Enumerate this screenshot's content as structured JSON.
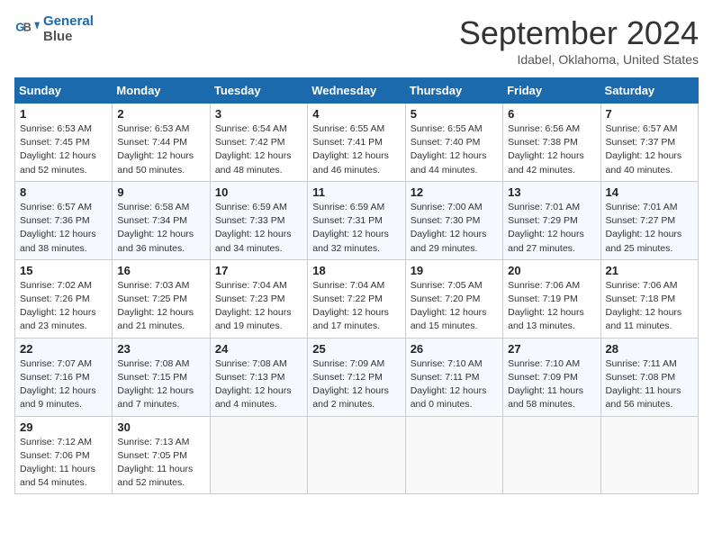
{
  "header": {
    "logo_line1": "General",
    "logo_line2": "Blue",
    "month": "September 2024",
    "location": "Idabel, Oklahoma, United States"
  },
  "weekdays": [
    "Sunday",
    "Monday",
    "Tuesday",
    "Wednesday",
    "Thursday",
    "Friday",
    "Saturday"
  ],
  "weeks": [
    [
      {
        "day": "1",
        "sunrise": "6:53 AM",
        "sunset": "7:45 PM",
        "daylight": "12 hours and 52 minutes."
      },
      {
        "day": "2",
        "sunrise": "6:53 AM",
        "sunset": "7:44 PM",
        "daylight": "12 hours and 50 minutes."
      },
      {
        "day": "3",
        "sunrise": "6:54 AM",
        "sunset": "7:42 PM",
        "daylight": "12 hours and 48 minutes."
      },
      {
        "day": "4",
        "sunrise": "6:55 AM",
        "sunset": "7:41 PM",
        "daylight": "12 hours and 46 minutes."
      },
      {
        "day": "5",
        "sunrise": "6:55 AM",
        "sunset": "7:40 PM",
        "daylight": "12 hours and 44 minutes."
      },
      {
        "day": "6",
        "sunrise": "6:56 AM",
        "sunset": "7:38 PM",
        "daylight": "12 hours and 42 minutes."
      },
      {
        "day": "7",
        "sunrise": "6:57 AM",
        "sunset": "7:37 PM",
        "daylight": "12 hours and 40 minutes."
      }
    ],
    [
      {
        "day": "8",
        "sunrise": "6:57 AM",
        "sunset": "7:36 PM",
        "daylight": "12 hours and 38 minutes."
      },
      {
        "day": "9",
        "sunrise": "6:58 AM",
        "sunset": "7:34 PM",
        "daylight": "12 hours and 36 minutes."
      },
      {
        "day": "10",
        "sunrise": "6:59 AM",
        "sunset": "7:33 PM",
        "daylight": "12 hours and 34 minutes."
      },
      {
        "day": "11",
        "sunrise": "6:59 AM",
        "sunset": "7:31 PM",
        "daylight": "12 hours and 32 minutes."
      },
      {
        "day": "12",
        "sunrise": "7:00 AM",
        "sunset": "7:30 PM",
        "daylight": "12 hours and 29 minutes."
      },
      {
        "day": "13",
        "sunrise": "7:01 AM",
        "sunset": "7:29 PM",
        "daylight": "12 hours and 27 minutes."
      },
      {
        "day": "14",
        "sunrise": "7:01 AM",
        "sunset": "7:27 PM",
        "daylight": "12 hours and 25 minutes."
      }
    ],
    [
      {
        "day": "15",
        "sunrise": "7:02 AM",
        "sunset": "7:26 PM",
        "daylight": "12 hours and 23 minutes."
      },
      {
        "day": "16",
        "sunrise": "7:03 AM",
        "sunset": "7:25 PM",
        "daylight": "12 hours and 21 minutes."
      },
      {
        "day": "17",
        "sunrise": "7:04 AM",
        "sunset": "7:23 PM",
        "daylight": "12 hours and 19 minutes."
      },
      {
        "day": "18",
        "sunrise": "7:04 AM",
        "sunset": "7:22 PM",
        "daylight": "12 hours and 17 minutes."
      },
      {
        "day": "19",
        "sunrise": "7:05 AM",
        "sunset": "7:20 PM",
        "daylight": "12 hours and 15 minutes."
      },
      {
        "day": "20",
        "sunrise": "7:06 AM",
        "sunset": "7:19 PM",
        "daylight": "12 hours and 13 minutes."
      },
      {
        "day": "21",
        "sunrise": "7:06 AM",
        "sunset": "7:18 PM",
        "daylight": "12 hours and 11 minutes."
      }
    ],
    [
      {
        "day": "22",
        "sunrise": "7:07 AM",
        "sunset": "7:16 PM",
        "daylight": "12 hours and 9 minutes."
      },
      {
        "day": "23",
        "sunrise": "7:08 AM",
        "sunset": "7:15 PM",
        "daylight": "12 hours and 7 minutes."
      },
      {
        "day": "24",
        "sunrise": "7:08 AM",
        "sunset": "7:13 PM",
        "daylight": "12 hours and 4 minutes."
      },
      {
        "day": "25",
        "sunrise": "7:09 AM",
        "sunset": "7:12 PM",
        "daylight": "12 hours and 2 minutes."
      },
      {
        "day": "26",
        "sunrise": "7:10 AM",
        "sunset": "7:11 PM",
        "daylight": "12 hours and 0 minutes."
      },
      {
        "day": "27",
        "sunrise": "7:10 AM",
        "sunset": "7:09 PM",
        "daylight": "11 hours and 58 minutes."
      },
      {
        "day": "28",
        "sunrise": "7:11 AM",
        "sunset": "7:08 PM",
        "daylight": "11 hours and 56 minutes."
      }
    ],
    [
      {
        "day": "29",
        "sunrise": "7:12 AM",
        "sunset": "7:06 PM",
        "daylight": "11 hours and 54 minutes."
      },
      {
        "day": "30",
        "sunrise": "7:13 AM",
        "sunset": "7:05 PM",
        "daylight": "11 hours and 52 minutes."
      },
      null,
      null,
      null,
      null,
      null
    ]
  ]
}
